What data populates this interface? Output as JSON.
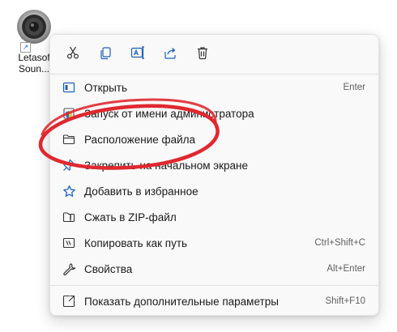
{
  "desktop": {
    "shortcut": {
      "label": "Letasof\nSoun...",
      "icon": "speaker-icon"
    }
  },
  "context_menu": {
    "toolbar": [
      {
        "name": "cut",
        "icon": "scissors-icon"
      },
      {
        "name": "copy",
        "icon": "copy-icon"
      },
      {
        "name": "rename",
        "icon": "rename-icon"
      },
      {
        "name": "share",
        "icon": "share-icon"
      },
      {
        "name": "delete",
        "icon": "trash-icon"
      }
    ],
    "items": [
      {
        "label": "Открыть",
        "shortcut": "Enter",
        "icon": "open-window-icon"
      },
      {
        "label": "Запуск от имени администратора",
        "shortcut": "",
        "icon": "shield-icon"
      },
      {
        "label": "Расположение файла",
        "shortcut": "",
        "icon": "folder-icon"
      },
      {
        "label": "Закрепить на начальном экране",
        "shortcut": "",
        "icon": "pin-icon"
      },
      {
        "label": "Добавить в избранное",
        "shortcut": "",
        "icon": "star-icon"
      },
      {
        "label": "Сжать в ZIP-файл",
        "shortcut": "",
        "icon": "zip-icon"
      },
      {
        "label": "Копировать как путь",
        "shortcut": "Ctrl+Shift+C",
        "icon": "copy-path-icon"
      },
      {
        "label": "Свойства",
        "shortcut": "Alt+Enter",
        "icon": "wrench-icon"
      },
      {
        "label": "Показать дополнительные параметры",
        "shortcut": "Shift+F10",
        "icon": "more-options-icon"
      }
    ]
  },
  "colors": {
    "accent": "#0067c0",
    "annotation": "#e0282f",
    "menu_bg": "#f9f9f9"
  }
}
